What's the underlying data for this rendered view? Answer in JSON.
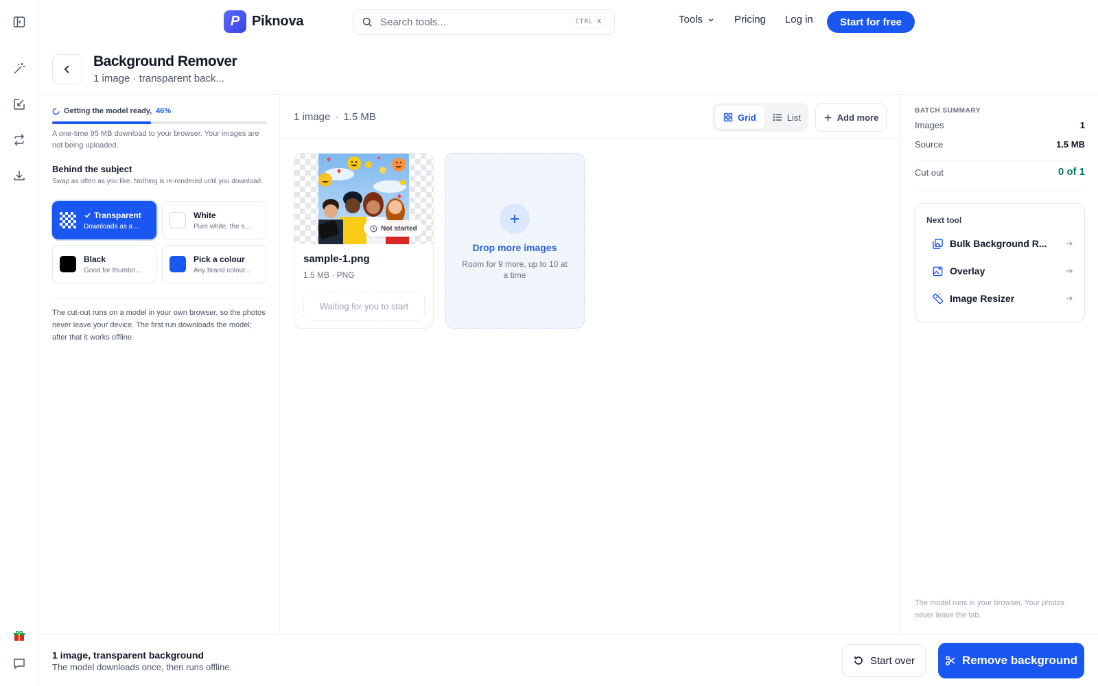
{
  "brand": {
    "name": "Piknova",
    "mark": "P"
  },
  "search": {
    "placeholder": "Search tools...",
    "shortcut": "CTRL K"
  },
  "nav": {
    "tools": "Tools",
    "pricing": "Pricing",
    "login": "Log in",
    "cta": "Start for free"
  },
  "header": {
    "title": "Background Remover",
    "subtitle": "1 image · transparent back..."
  },
  "model": {
    "status": "Getting the model ready,",
    "percent_label": "46%",
    "progress": 0.46,
    "note": "A one-time 95 MB download to your browser. Your images are not being uploaded."
  },
  "background": {
    "title": "Behind the subject",
    "subtitle": "Swap as often as you like. Nothing is re-rendered until you download.",
    "options": [
      {
        "label": "Transparent",
        "desc": "Downloads as a ...",
        "selected": true
      },
      {
        "label": "White",
        "desc": "Pure white, the s...",
        "color": "#ffffff"
      },
      {
        "label": "Black",
        "desc": "Good for thumbn...",
        "color": "#000000"
      },
      {
        "label": "Pick a colour",
        "desc": "Any brand colour...",
        "color": "#1a56f0"
      }
    ],
    "note": "The cut-out runs on a model in your own browser, so the photos never leave your device. The first run downloads the model; after that it works offline."
  },
  "main": {
    "count": "1 image",
    "size": "1.5 MB",
    "view_grid": "Grid",
    "view_list": "List",
    "add_more": "Add more",
    "file": {
      "name": "sample-1.png",
      "meta": "1.5 MB · PNG",
      "status": "Not started",
      "action": "Waiting for you to start"
    },
    "dropzone": {
      "title": "Drop more images",
      "subtitle": "Room for 9 more, up to 10 at a time"
    }
  },
  "summary": {
    "heading": "BATCH SUMMARY",
    "images_label": "Images",
    "images_value": "1",
    "source_label": "Source",
    "source_value": "1.5 MB",
    "cut_label": "Cut out",
    "cut_value": "0 of 1"
  },
  "next_tool": {
    "title": "Next tool",
    "items": [
      {
        "label": "Bulk Background R...",
        "icon": "bulk-images-icon"
      },
      {
        "label": "Overlay",
        "icon": "overlay-image-icon"
      },
      {
        "label": "Image Resizer",
        "icon": "ruler-icon"
      }
    ]
  },
  "right_footer": "The model runs in your browser. Your photos never leave the tab.",
  "footer": {
    "title": "1 image, transparent background",
    "subtitle": "The model downloads once, then runs offline.",
    "start_over": "Start over",
    "remove": "Remove background"
  },
  "colors": {
    "accent": "#1a56f0",
    "success": "#047857"
  }
}
